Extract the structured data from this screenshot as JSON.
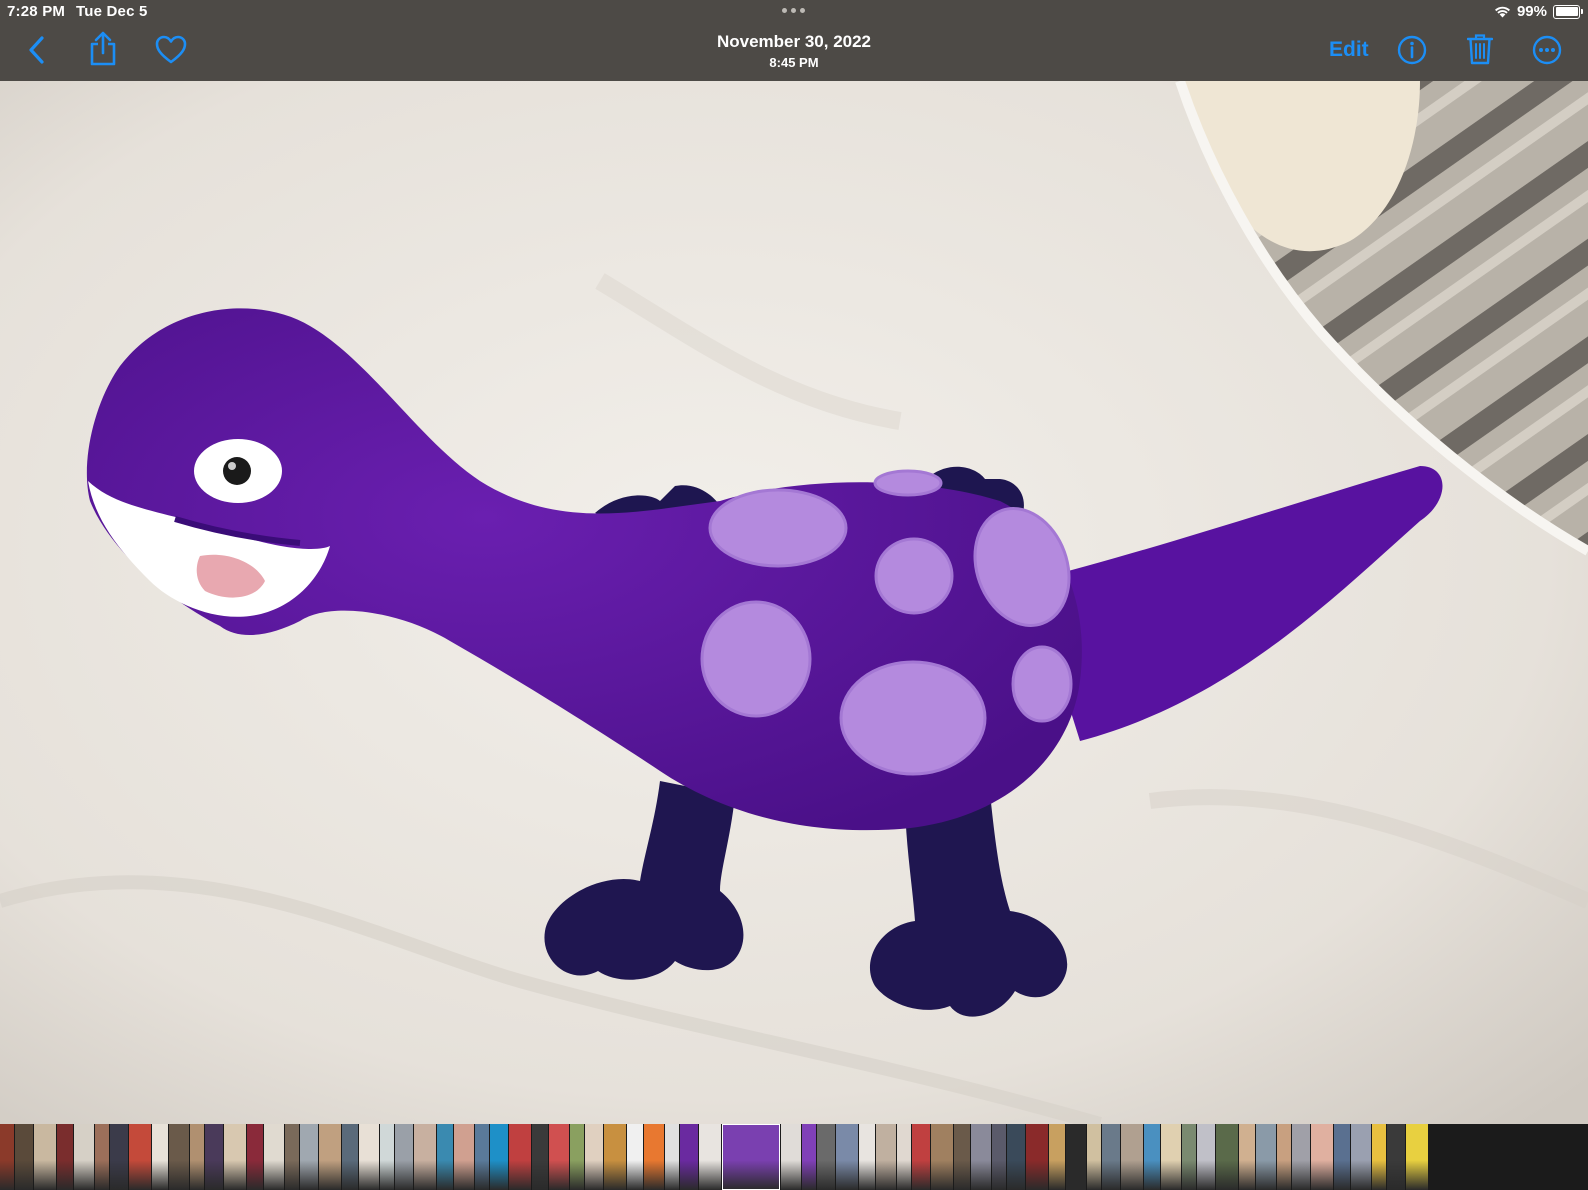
{
  "status_bar": {
    "time": "7:28 PM",
    "date": "Tue Dec 5",
    "battery": "99%"
  },
  "toolbar": {
    "date": "November 30, 2022",
    "time": "8:45 PM",
    "edit_label": "Edit",
    "icons": [
      "back-icon",
      "share-icon",
      "heart-icon",
      "info-icon",
      "trash-icon",
      "more-icon"
    ],
    "accent_color": "#1c8ef5"
  },
  "photo": {
    "subject": "crochet-purple-dinosaur"
  },
  "filmstrip": {
    "thumbnail_colors": [
      "#8b3a2a",
      "#5a4a3a",
      "#c9b8a0",
      "#7a2d2d",
      "#d6d0c6",
      "#9c6f5a",
      "#3b3b4a",
      "#c44a3a",
      "#e8e2d8",
      "#6a5a4a",
      "#b09070",
      "#4a3a5a",
      "#d8c8b0",
      "#8a2a3a",
      "#e0dad0",
      "#7a6a5a",
      "#a0a8b0",
      "#c0a080",
      "#5a6a7a",
      "#e8e0d6",
      "#d0d8d8",
      "#9aa0a8",
      "#c8b0a0",
      "#3a8ab0",
      "#d0a090",
      "#5a7a9a",
      "#1e90c8",
      "#c04040",
      "#3a3a3a",
      "#d05050",
      "#8aa060",
      "#e0d0c0",
      "#c89040",
      "#f0f0f0",
      "#e87830",
      "#e0e0e0",
      "#6a2aa0",
      "#e8e4e0",
      "#7a40b0",
      "#e0dcd8",
      "#8040b8",
      "#6a6a6a",
      "#7a8aa8",
      "#e8e4e0",
      "#c0b0a0",
      "#e0d8d0",
      "#c04040",
      "#a08060",
      "#6a5a4a",
      "#8a8a9a",
      "#5a5a6a",
      "#3a4a5a",
      "#8a2a2a",
      "#c8a060",
      "#2a2a2a",
      "#d0c0a0",
      "#6a7a8a",
      "#b0a090",
      "#4a90c0",
      "#e0d0b0",
      "#7a8a70",
      "#c0c0c8",
      "#5a6a4a",
      "#d0b090",
      "#8a9aa8",
      "#c8a080",
      "#a0a0a8",
      "#e0b0a0",
      "#5a7090",
      "#9aa0b0",
      "#e8c040",
      "#3a3a3a",
      "#e8d040"
    ]
  }
}
